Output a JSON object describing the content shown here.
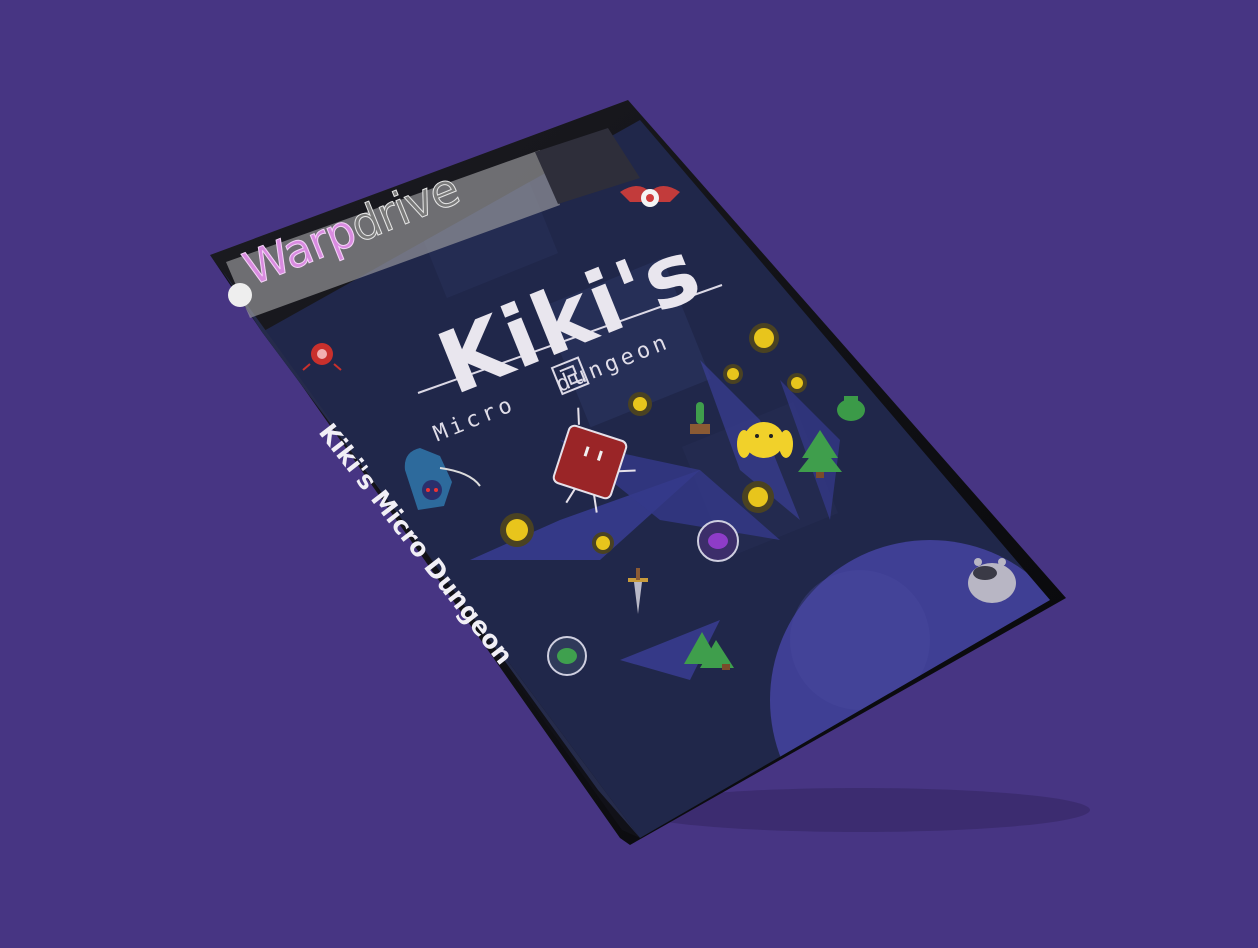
{
  "box": {
    "brand_part1": "Warp",
    "brand_part2": "drive",
    "title": "Kiki's",
    "subtitle_left": "Micro",
    "subtitle_right": "dungeon",
    "spine_text": "Kiki's Micro Dungeon"
  },
  "colors": {
    "background": "#473583",
    "cover": "#20274a",
    "brand_pink": "#d98be0",
    "coin": "#e8c51c",
    "tree": "#3f9e4c"
  }
}
